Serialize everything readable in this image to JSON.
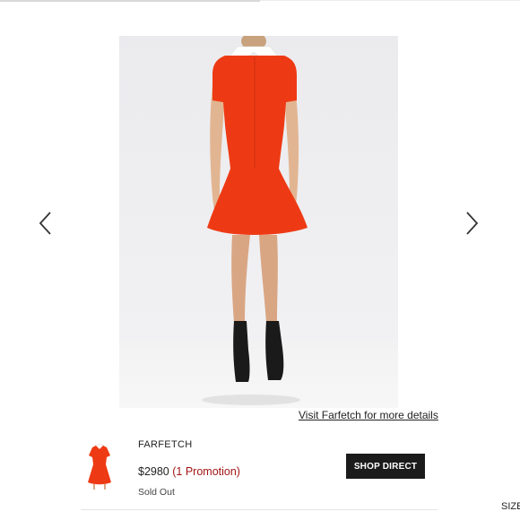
{
  "carousel": {
    "prev_icon": "chevron-left-icon",
    "next_icon": "chevron-right-icon",
    "details_link": "Visit Farfetch for more details"
  },
  "offer": {
    "retailer": "FARFETCH",
    "price": "$2980",
    "promotion": "(1 Promotion)",
    "stock_status": "Sold Out",
    "shop_button": "SHOP DIRECT"
  },
  "side_panel": {
    "size_label": "SIZE"
  },
  "colors": {
    "dress": "#ee3a14",
    "promotion_text": "#a21616",
    "button_bg": "#1b1b1b"
  }
}
